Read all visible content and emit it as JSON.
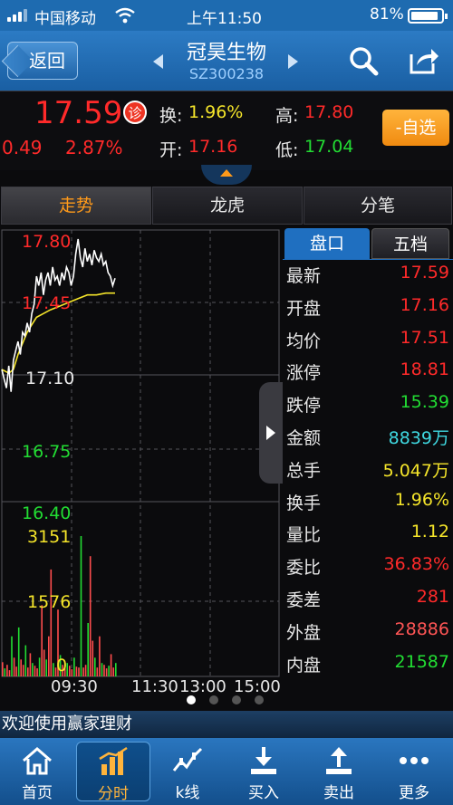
{
  "status": {
    "carrier": "中国移动",
    "time": "上午11:50",
    "battery": "81%"
  },
  "nav": {
    "back": "返回",
    "name": "冠昊生物",
    "code": "SZ300238"
  },
  "quote": {
    "price": "17.59",
    "diag": "诊",
    "change": "0.49",
    "change_pct": "2.87%",
    "turnover_label": "换:",
    "turnover": "1.96%",
    "open_label": "开:",
    "open": "17.16",
    "high_label": "高:",
    "high": "17.80",
    "low_label": "低:",
    "low": "17.04",
    "watch": "-自选"
  },
  "tabs": [
    "走势",
    "龙虎",
    "分笔"
  ],
  "panel": {
    "tabs": [
      "盘口",
      "五档"
    ],
    "rows": [
      {
        "k": "最新",
        "v": "17.59",
        "color": "#ff2a2a"
      },
      {
        "k": "开盘",
        "v": "17.16",
        "color": "#ff2a2a"
      },
      {
        "k": "均价",
        "v": "17.51",
        "color": "#ff2a2a"
      },
      {
        "k": "涨停",
        "v": "18.81",
        "color": "#ff2a2a"
      },
      {
        "k": "跌停",
        "v": "15.39",
        "color": "#22dd33"
      },
      {
        "k": "金额",
        "v": "8839万",
        "color": "#3fd8e0"
      },
      {
        "k": "总手",
        "v": "5.047万",
        "color": "#f5e52a"
      },
      {
        "k": "换手",
        "v": "1.96%",
        "color": "#f5e52a"
      },
      {
        "k": "量比",
        "v": "1.12",
        "color": "#f5e52a"
      },
      {
        "k": "委比",
        "v": "36.83%",
        "color": "#ff2a2a"
      },
      {
        "k": "委差",
        "v": "281",
        "color": "#ff2a2a"
      },
      {
        "k": "外盘",
        "v": "28886",
        "color": "#ff5555"
      },
      {
        "k": "内盘",
        "v": "21587",
        "color": "#22dd33"
      }
    ]
  },
  "chart_data": {
    "type": "line",
    "price_axis": [
      "17.80",
      "17.45",
      "17.10",
      "16.75",
      "16.40"
    ],
    "price_axis_values": [
      17.8,
      17.45,
      17.1,
      16.75,
      16.4
    ],
    "volume_axis": [
      "3151",
      "1576",
      "0"
    ],
    "volume_max": 3151,
    "time_axis": [
      "09:30",
      "11:30",
      "13:00",
      "15:00"
    ],
    "total_minutes": 240,
    "price_series": [
      [
        0,
        17.1
      ],
      [
        2,
        17.05
      ],
      [
        4,
        17.0
      ],
      [
        6,
        17.12
      ],
      [
        8,
        16.98
      ],
      [
        10,
        17.15
      ],
      [
        12,
        17.2
      ],
      [
        14,
        17.25
      ],
      [
        16,
        17.18
      ],
      [
        18,
        17.3
      ],
      [
        20,
        17.28
      ],
      [
        22,
        17.35
      ],
      [
        24,
        17.3
      ],
      [
        26,
        17.4
      ],
      [
        28,
        17.45
      ],
      [
        30,
        17.6
      ],
      [
        32,
        17.55
      ],
      [
        34,
        17.62
      ],
      [
        36,
        17.5
      ],
      [
        38,
        17.58
      ],
      [
        40,
        17.62
      ],
      [
        42,
        17.55
      ],
      [
        44,
        17.65
      ],
      [
        46,
        17.58
      ],
      [
        48,
        17.6
      ],
      [
        50,
        17.55
      ],
      [
        52,
        17.62
      ],
      [
        54,
        17.58
      ],
      [
        56,
        17.65
      ],
      [
        58,
        17.62
      ],
      [
        60,
        17.55
      ],
      [
        62,
        17.6
      ],
      [
        64,
        17.72
      ],
      [
        66,
        17.8
      ],
      [
        68,
        17.7
      ],
      [
        70,
        17.65
      ],
      [
        72,
        17.75
      ],
      [
        74,
        17.68
      ],
      [
        76,
        17.72
      ],
      [
        78,
        17.66
      ],
      [
        80,
        17.74
      ],
      [
        82,
        17.7
      ],
      [
        84,
        17.68
      ],
      [
        86,
        17.72
      ],
      [
        88,
        17.66
      ],
      [
        90,
        17.68
      ],
      [
        92,
        17.62
      ],
      [
        94,
        17.6
      ],
      [
        96,
        17.55
      ],
      [
        98,
        17.59
      ]
    ],
    "avg_series": [
      [
        0,
        17.1
      ],
      [
        6,
        17.08
      ],
      [
        10,
        17.1
      ],
      [
        14,
        17.18
      ],
      [
        18,
        17.24
      ],
      [
        22,
        17.3
      ],
      [
        26,
        17.34
      ],
      [
        30,
        17.38
      ],
      [
        36,
        17.4
      ],
      [
        42,
        17.42
      ],
      [
        50,
        17.44
      ],
      [
        58,
        17.46
      ],
      [
        66,
        17.48
      ],
      [
        74,
        17.5
      ],
      [
        82,
        17.5
      ],
      [
        90,
        17.51
      ],
      [
        98,
        17.51
      ]
    ],
    "volume": [
      320,
      180,
      260,
      140,
      900,
      420,
      220,
      1100,
      380,
      260,
      700,
      200,
      520,
      300,
      240,
      180,
      420,
      1600,
      600,
      380,
      900,
      2400,
      300,
      200,
      1500,
      480,
      260,
      180,
      300,
      240,
      160,
      420,
      220,
      200,
      3151,
      200,
      260,
      1200,
      2700,
      800,
      420,
      200,
      900,
      300,
      260,
      180,
      240,
      500,
      200,
      300
    ]
  },
  "banner": "欢迎使用赢家理财",
  "bottom_nav": [
    "首页",
    "分时",
    "k线",
    "买入",
    "卖出",
    "更多"
  ]
}
